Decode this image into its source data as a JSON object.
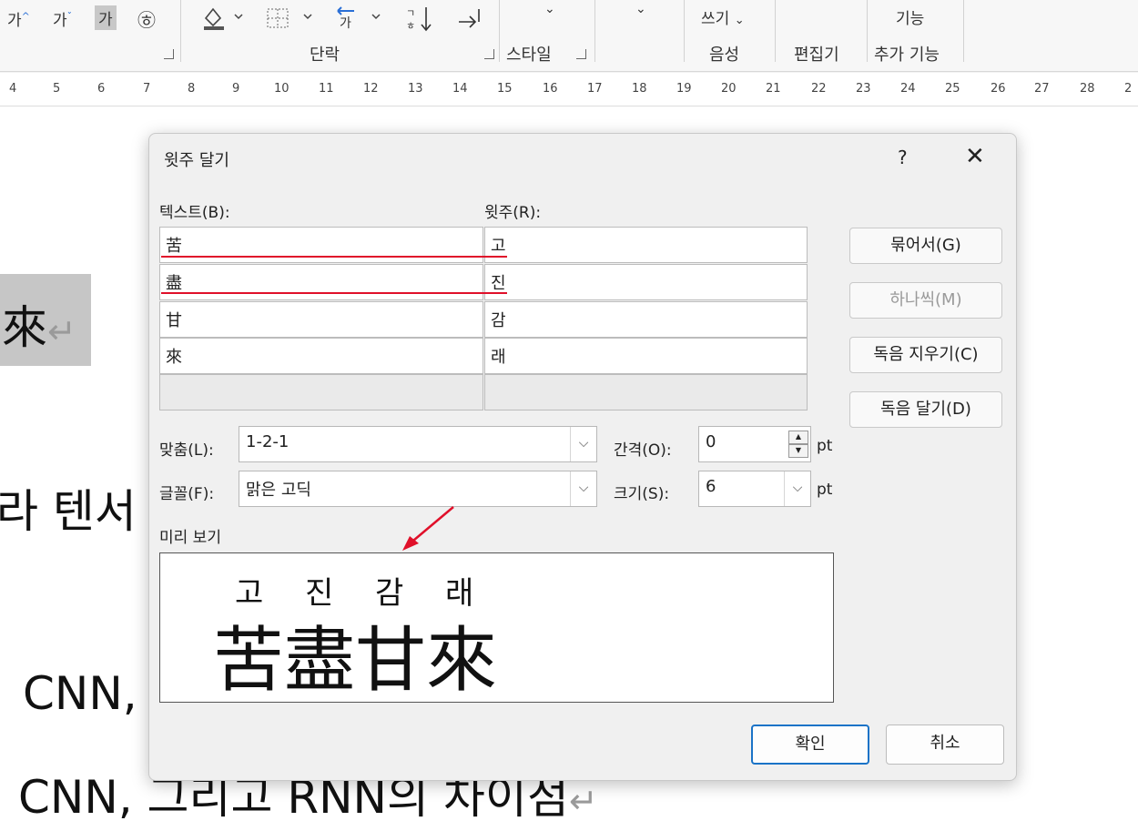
{
  "ribbon": {
    "btn_grow": "가",
    "btn_shrink": "가",
    "btn_clear": "가",
    "btn_encircle": "㉭",
    "group_paragraph": "단락",
    "group_style": "스타일",
    "btn_dictate": "쓰기",
    "group_voice": "음성",
    "group_editor": "편집기",
    "btn_addin": "기능",
    "group_addins": "추가 기능"
  },
  "ruler": {
    "ticks": [
      "4",
      "5",
      "6",
      "7",
      "8",
      "9",
      "10",
      "11",
      "12",
      "13",
      "14",
      "15",
      "16",
      "17",
      "18",
      "19",
      "20",
      "21",
      "22",
      "23",
      "24",
      "25",
      "26",
      "27",
      "28",
      "2"
    ]
  },
  "document": {
    "line1": "來",
    "line2": "라 텐서",
    "line3": "CNN,",
    "line4": "CNN, 그리고 RNN의 차이점",
    "para_mark": "↵"
  },
  "dialog": {
    "title": "윗주 달기",
    "help": "?",
    "close": "✕",
    "text_label": "텍스트(B):",
    "ruby_label": "윗주(R):",
    "rows": [
      {
        "text": "苦",
        "ruby": "고"
      },
      {
        "text": "盡",
        "ruby": "진"
      },
      {
        "text": "甘",
        "ruby": "감"
      },
      {
        "text": "來",
        "ruby": "래"
      }
    ],
    "btn_group": "묶어서(G)",
    "btn_mono": "하나씩(M)",
    "btn_clear_reading": "독음 지우기(C)",
    "btn_default_reading": "독음 달기(D)",
    "align_label": "맞춤(L):",
    "align_value": "1-2-1",
    "offset_label": "간격(O):",
    "offset_value": "0",
    "font_label": "글꼴(F):",
    "font_value": "맑은 고딕",
    "size_label": "크기(S):",
    "size_value": "6",
    "unit": "pt",
    "preview_label": "미리 보기",
    "preview_ruby": [
      "고",
      "진",
      "감",
      "래"
    ],
    "preview_base": "苦盡甘來",
    "ok": "확인",
    "cancel": "취소"
  },
  "colors": {
    "accent": "#1a73c7",
    "annotation": "#e0102a"
  }
}
